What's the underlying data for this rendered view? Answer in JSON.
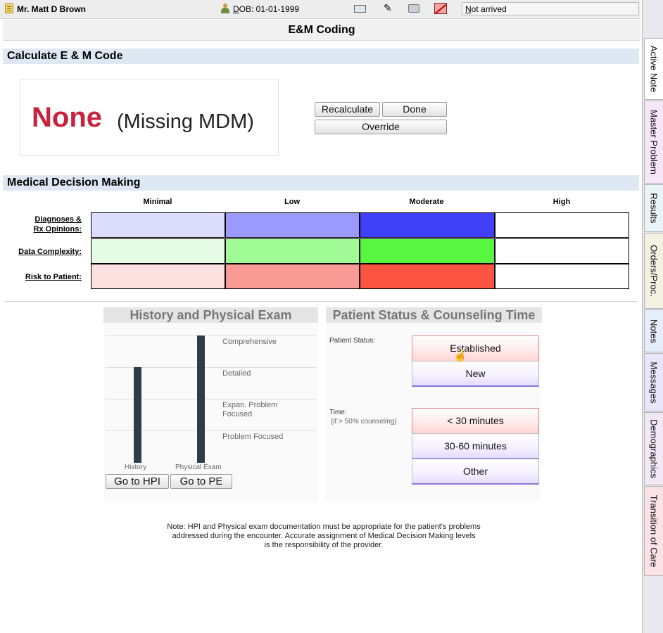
{
  "topbar": {
    "patient_name": "Mr. Matt D Brown",
    "dob": "DOB: 01-01-1999",
    "status": "Not arrived"
  },
  "page_title": "E&M Coding",
  "calc": {
    "heading": "Calculate E & M Code",
    "code": "None",
    "code_note": "(Missing MDM)",
    "recalculate_label": "Recalculate",
    "done_label": "Done",
    "override_label": "Override"
  },
  "mdm": {
    "heading": "Medical Decision Making",
    "columns": [
      "Minimal",
      "Low",
      "Moderate",
      "High"
    ],
    "rows": [
      {
        "label_line1": "Diagnoses &",
        "label_line2": "Rx Opinions:",
        "colors": [
          "#dcdcfc",
          "#9a9afc",
          "#4040f8",
          "#ffffff"
        ]
      },
      {
        "label": "Data Complexity:",
        "colors": [
          "#e6fbe6",
          "#a0fa96",
          "#58f541",
          "#ffffff"
        ]
      },
      {
        "label": "Risk to Patient:",
        "colors": [
          "#fde0e0",
          "#fa9a94",
          "#fb5442",
          "#ffffff"
        ]
      }
    ]
  },
  "history": {
    "heading": "History and Physical Exam",
    "levels": [
      "Comprehensive",
      "Detailed",
      "Expan. Problem Focused",
      "Problem Focused"
    ],
    "bar_labels": [
      "History",
      "Physical Exam"
    ],
    "history_level": "Detailed",
    "physical_exam_level": "Comprehensive",
    "go_hpi_label": "Go to HPI",
    "go_pe_label": "Go to PE"
  },
  "status": {
    "heading": "Patient Status & Counseling Time",
    "patient_status_label": "Patient Status:",
    "patient_status_options": [
      "Established",
      "New"
    ],
    "patient_status_selected": "Established",
    "time_label": "Time:",
    "time_sublabel": "(if > 50% counseling)",
    "time_options": [
      "< 30 minutes",
      "30-60 minutes",
      "Other"
    ],
    "time_selected": "< 30 minutes"
  },
  "note": {
    "line1": "Note: HPI and Physical exam documentation must be appropriate for the patient's problems",
    "line2": "addressed during the encounter. Accurate assignment of Medical Decision Making levels",
    "line3": "is the responsibility of the provider."
  },
  "side_tabs": [
    "Active Note",
    "Master Problem",
    "Results",
    "Orders/Proc.",
    "Notes",
    "Messages",
    "Demographics",
    "Transition of Care"
  ]
}
